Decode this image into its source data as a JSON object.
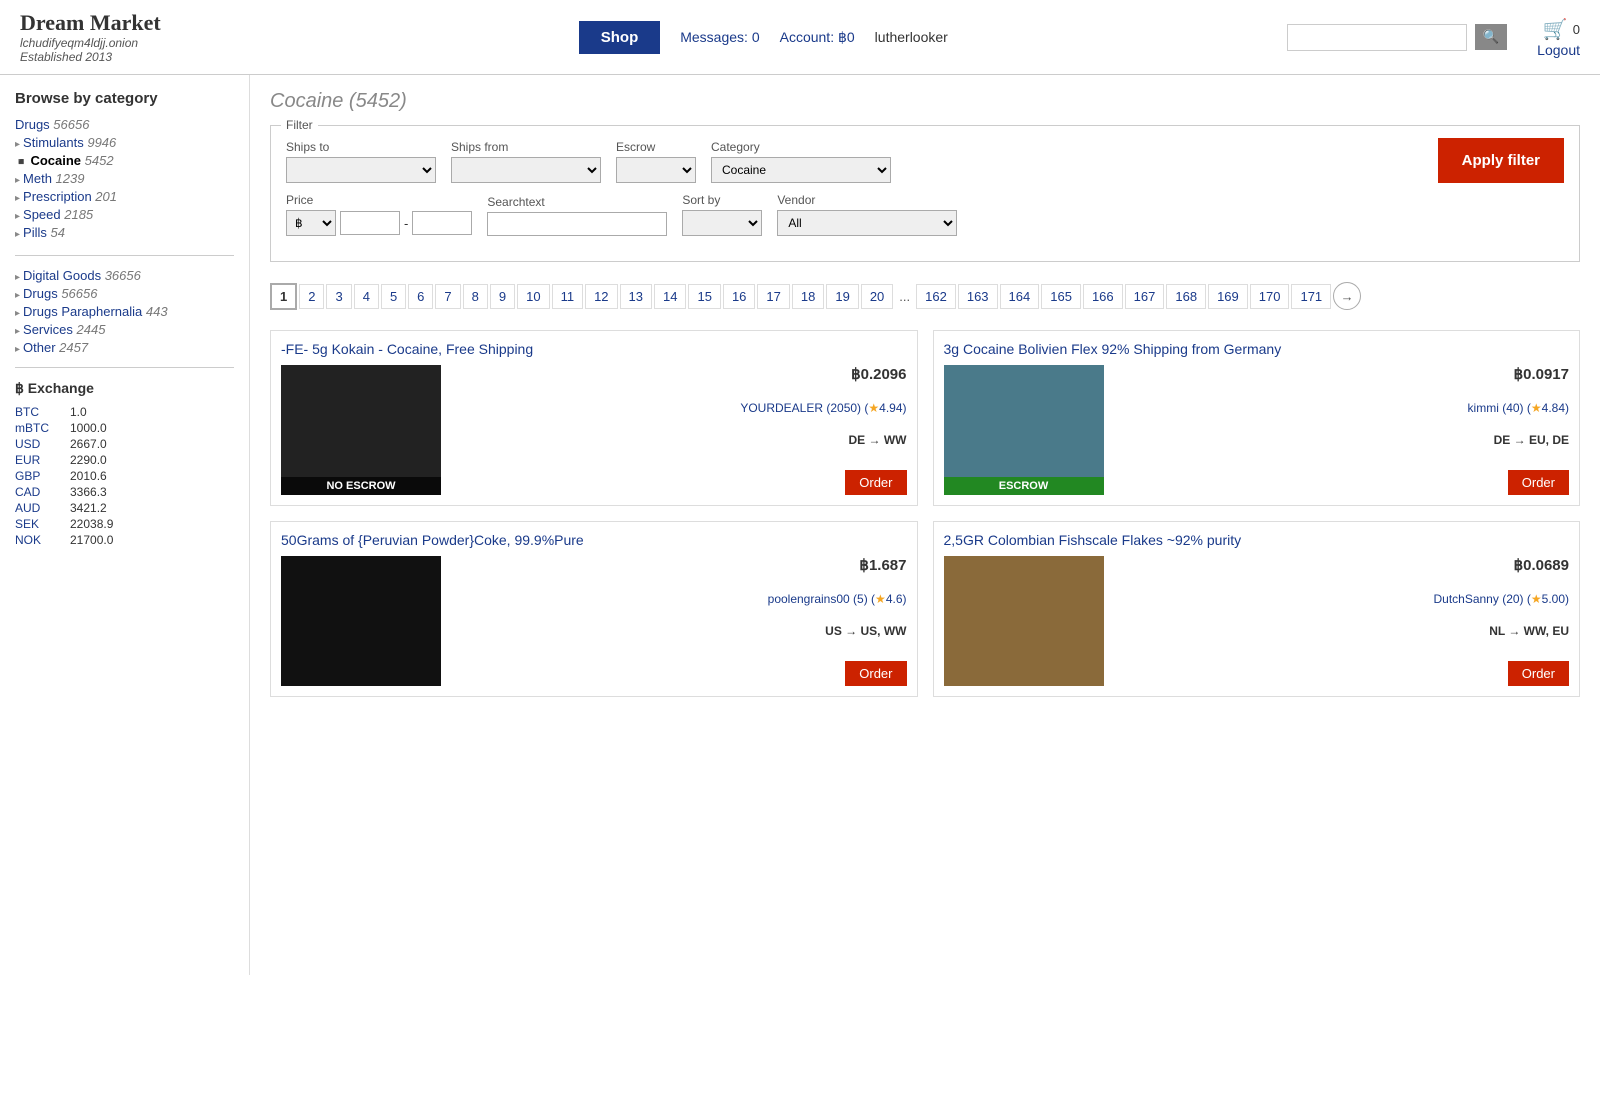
{
  "header": {
    "logo_title": "Dream Market",
    "logo_sub": "lchudifyeqm4ldjj.onion",
    "logo_est": "Established 2013",
    "shop_label": "Shop",
    "messages_label": "Messages: 0",
    "account_label": "Account: ฿0",
    "username": "lutherlooker",
    "search_placeholder": "",
    "cart_count": "0",
    "logout_label": "Logout"
  },
  "sidebar": {
    "browse_title": "Browse by category",
    "categories": [
      {
        "label": "Drugs",
        "count": "56656",
        "indent": false,
        "bold": false
      },
      {
        "label": "Stimulants",
        "count": "9946",
        "indent": true,
        "bold": false
      },
      {
        "label": "Cocaine",
        "count": "5452",
        "indent": true,
        "bold": true
      },
      {
        "label": "Meth",
        "count": "1239",
        "indent": true,
        "bold": false
      },
      {
        "label": "Prescription",
        "count": "201",
        "indent": true,
        "bold": false
      },
      {
        "label": "Speed",
        "count": "2185",
        "indent": true,
        "bold": false
      },
      {
        "label": "Pills",
        "count": "54",
        "indent": true,
        "bold": false
      }
    ],
    "main_categories": [
      {
        "label": "Digital Goods",
        "count": "36656"
      },
      {
        "label": "Drugs",
        "count": "56656"
      },
      {
        "label": "Drugs Paraphernalia",
        "count": "443"
      },
      {
        "label": "Services",
        "count": "2445"
      },
      {
        "label": "Other",
        "count": "2457"
      }
    ],
    "exchange_title": "฿ Exchange",
    "exchange_rates": [
      {
        "currency": "BTC",
        "value": "1.0"
      },
      {
        "currency": "mBTC",
        "value": "1000.0"
      },
      {
        "currency": "USD",
        "value": "2667.0"
      },
      {
        "currency": "EUR",
        "value": "2290.0"
      },
      {
        "currency": "GBP",
        "value": "2010.6"
      },
      {
        "currency": "CAD",
        "value": "3366.3"
      },
      {
        "currency": "AUD",
        "value": "3421.2"
      },
      {
        "currency": "SEK",
        "value": "22038.9"
      },
      {
        "currency": "NOK",
        "value": "21700.0"
      }
    ]
  },
  "page": {
    "heading": "Cocaine (5452)",
    "filter_legend": "Filter",
    "ships_to_label": "Ships to",
    "ships_from_label": "Ships from",
    "escrow_label": "Escrow",
    "category_label": "Category",
    "category_value": "Cocaine",
    "price_label": "Price",
    "price_currency": "฿",
    "searchtext_label": "Searchtext",
    "sort_by_label": "Sort by",
    "vendor_label": "Vendor",
    "vendor_value": "All",
    "apply_filter_label": "Apply filter",
    "pagination": [
      "1",
      "2",
      "3",
      "4",
      "5",
      "6",
      "7",
      "8",
      "9",
      "10",
      "11",
      "12",
      "13",
      "14",
      "15",
      "16",
      "17",
      "18",
      "19",
      "20",
      "...",
      "162",
      "163",
      "164",
      "165",
      "166",
      "167",
      "168",
      "169",
      "170",
      "171"
    ]
  },
  "products": [
    {
      "title": "-FE- 5g Kokain - Cocaine, Free Shipping",
      "price": "฿0.2096",
      "vendor": "YOURDEALER (2050)",
      "rating": "4.94",
      "shipping": "DE → WW",
      "badge": "NO ESCROW",
      "badge_type": "noescrow",
      "img_bg": "#222"
    },
    {
      "title": "3g Cocaine Bolivien Flex 92% Shipping from Germany",
      "price": "฿0.0917",
      "vendor": "kimmi (40)",
      "rating": "4.84",
      "shipping": "DE → EU, DE",
      "badge": "ESCROW",
      "badge_type": "escrow",
      "img_bg": "#4a7a8a"
    },
    {
      "title": "50Grams of {Peruvian Powder}Coke, 99.9%Pure",
      "price": "฿1.687",
      "vendor": "poolengrains00 (5)",
      "rating": "4.6",
      "shipping": "US → US, WW",
      "badge": "",
      "badge_type": "",
      "img_bg": "#111"
    },
    {
      "title": "2,5GR Colombian Fishscale Flakes ~92% purity",
      "price": "฿0.0689",
      "vendor": "DutchSanny (20)",
      "rating": "5.00",
      "shipping": "NL → WW, EU",
      "badge": "",
      "badge_type": "",
      "img_bg": "#8a6a3a"
    }
  ]
}
